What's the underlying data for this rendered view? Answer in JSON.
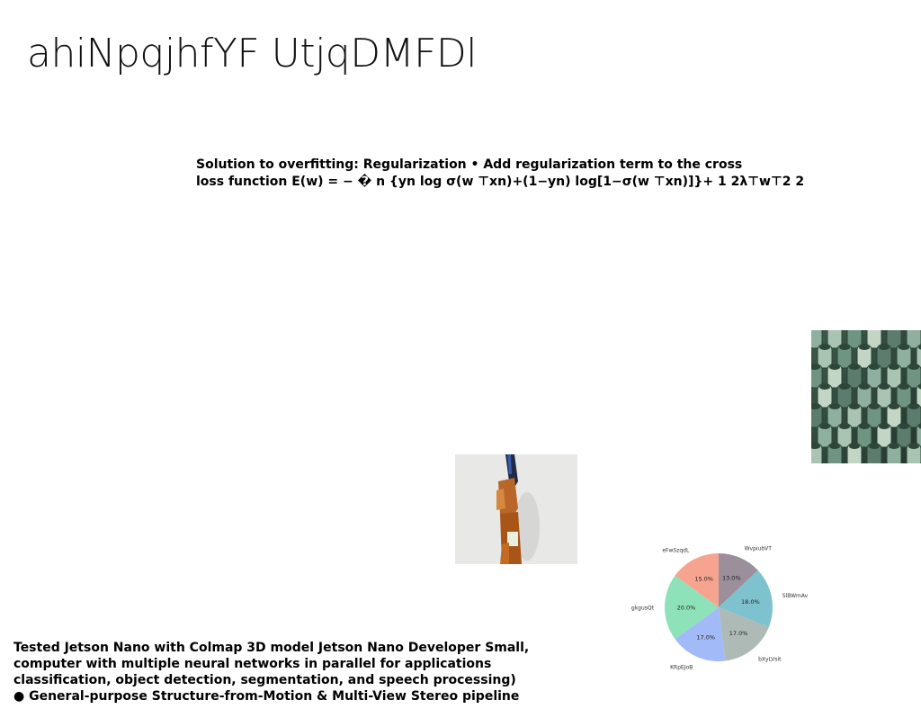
{
  "slide": {
    "title": "ahiNpqjhfYF UtjqDMFDl"
  },
  "formula": {
    "line1": "Solution to overfitting: Regularization • Add regularization term to the cross",
    "line2": "loss function E(w) = − � n {yn log σ(w ⊤xn)+(1−yn) log[1−σ(w ⊤xn)]}+ 1 2λ⊤w⊤2 2"
  },
  "bottom_text": {
    "line1": "Tested Jetson Nano with Colmap 3D model Jetson Nano Developer Small,",
    "line2": "computer with multiple neural networks in parallel for applications",
    "line3": "classification, object detection, segmentation, and speech processing)",
    "line4": "● General-purpose Structure-from-Motion & Multi-View Stereo pipeline"
  },
  "images": {
    "tile": "green-tubes-image",
    "figure": "dressed-figure-image"
  },
  "chart_data": {
    "type": "pie",
    "title": "",
    "slices": [
      {
        "label": "WvpiubVT",
        "value": 13.0,
        "pct": "13.0%",
        "color": "#9a8f9b"
      },
      {
        "label": "SlBWmAv",
        "value": 18.0,
        "pct": "18.0%",
        "color": "#7fc2cf"
      },
      {
        "label": "bXyLVsit",
        "value": 17.0,
        "pct": "17.0%",
        "color": "#aebab5"
      },
      {
        "label": "KRpEJoB",
        "value": 17.0,
        "pct": "17.0%",
        "color": "#a2baf8"
      },
      {
        "label": "gkgusQt",
        "value": 20.0,
        "pct": "20.0%",
        "color": "#8de2b9"
      },
      {
        "label": "eFwSzqdL",
        "value": 15.0,
        "pct": "15.0%",
        "color": "#f6a48f"
      }
    ],
    "start_angle": "top",
    "direction": "clockwise"
  }
}
